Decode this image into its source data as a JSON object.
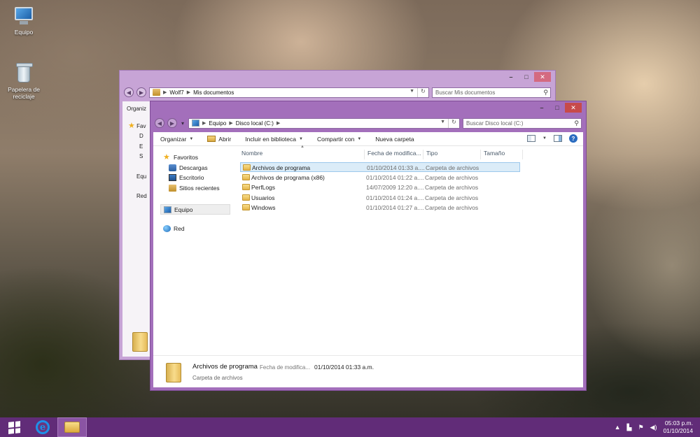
{
  "desktop": {
    "icons": [
      {
        "label": "Equipo",
        "icon": "computer-icon"
      },
      {
        "label": "Papelera de reciclaje",
        "icon": "recycle-bin-icon"
      }
    ]
  },
  "back_window": {
    "address": {
      "segments": [
        "Wolf7",
        "Mis documentos"
      ]
    },
    "search_placeholder": "Buscar Mis documentos",
    "toolbar_first": "Organiz",
    "nav_snippets": [
      "Fav",
      "D",
      "E",
      "S",
      "Equ",
      "Red"
    ]
  },
  "front_window": {
    "address": {
      "segments": [
        "Equipo",
        "Disco local (C:)"
      ]
    },
    "search_placeholder": "Buscar Disco local (C:)",
    "toolbar": {
      "organize": "Organizar",
      "open": "Abrir",
      "include": "Incluir en biblioteca",
      "share": "Compartir con",
      "new_folder": "Nueva carpeta"
    },
    "nav": {
      "favorites": "Favoritos",
      "downloads": "Descargas",
      "desktop": "Escritorio",
      "recent": "Sitios recientes",
      "computer": "Equipo",
      "network": "Red"
    },
    "columns": {
      "name": "Nombre",
      "date": "Fecha de modifica...",
      "type": "Tipo",
      "size": "Tamaño"
    },
    "files": [
      {
        "name": "Archivos de programa",
        "date": "01/10/2014 01:33 a....",
        "type": "Carpeta de archivos"
      },
      {
        "name": "Archivos de programa (x86)",
        "date": "01/10/2014 01:22 a....",
        "type": "Carpeta de archivos"
      },
      {
        "name": "PerfLogs",
        "date": "14/07/2009 12:20 a....",
        "type": "Carpeta de archivos"
      },
      {
        "name": "Usuarios",
        "date": "01/10/2014 01:24 a....",
        "type": "Carpeta de archivos"
      },
      {
        "name": "Windows",
        "date": "01/10/2014 01:27 a....",
        "type": "Carpeta de archivos"
      }
    ],
    "selected_index": 0,
    "details": {
      "name": "Archivos de programa",
      "date_label": "Fecha de modifica...",
      "date_value": "01/10/2014 01:33 a.m.",
      "type": "Carpeta de archivos"
    }
  },
  "taskbar": {
    "apps": [
      "internet-explorer-icon",
      "file-explorer-icon"
    ],
    "clock": {
      "time": "05:03 p.m.",
      "date": "01/10/2014"
    }
  },
  "colors": {
    "window_frame": "#a36fbb",
    "taskbar": "#612c78",
    "selection": "#dbecf8",
    "close_button": "#c74a4a"
  }
}
